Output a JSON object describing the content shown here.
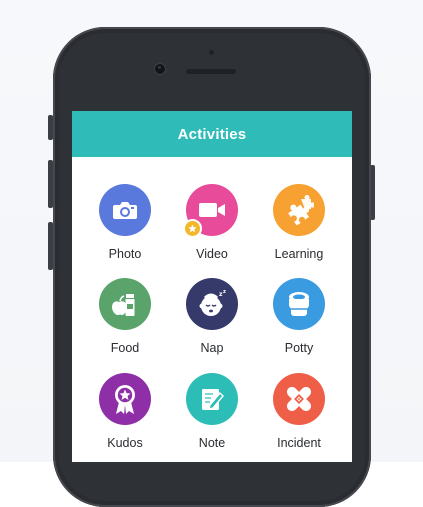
{
  "screen_title": "Activities",
  "activities": [
    {
      "label": "Photo",
      "icon": "camera-icon",
      "color": "#5a79dd"
    },
    {
      "label": "Video",
      "icon": "video-camera-icon",
      "color": "#e74b9a",
      "badge": "star-icon"
    },
    {
      "label": "Learning",
      "icon": "puzzle-piece-icon",
      "color": "#f8a133"
    },
    {
      "label": "Food",
      "icon": "apple-milk-icon",
      "color": "#5aa46c"
    },
    {
      "label": "Nap",
      "icon": "sleeping-baby-icon",
      "color": "#353a6b"
    },
    {
      "label": "Potty",
      "icon": "potty-icon",
      "color": "#3a9be0"
    },
    {
      "label": "Kudos",
      "icon": "award-ribbon-icon",
      "color": "#8e2fa8"
    },
    {
      "label": "Note",
      "icon": "note-pencil-icon",
      "color": "#2dbdb7"
    },
    {
      "label": "Incident",
      "icon": "bandage-icon",
      "color": "#ef5e47"
    }
  ]
}
